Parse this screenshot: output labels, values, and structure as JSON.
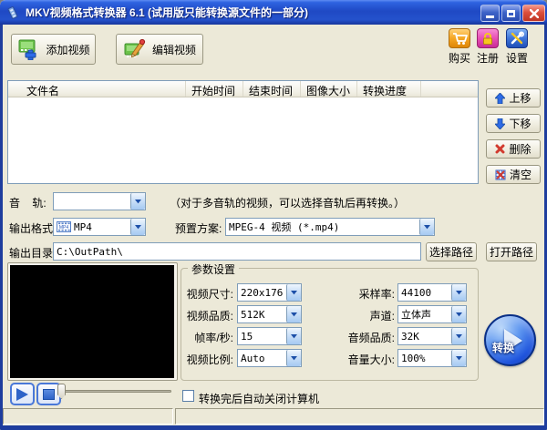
{
  "titlebar": {
    "title": "MKV视频格式转换器 6.1 (试用版只能转换源文件的一部分)"
  },
  "toolbar": {
    "add_video_label": "添加视频",
    "edit_video_label": "编辑视频",
    "buy_label": "购买",
    "register_label": "注册",
    "settings_label": "设置"
  },
  "file_list": {
    "columns": [
      "文件名",
      "开始时间",
      "结束时间",
      "图像大小",
      "转换进度"
    ],
    "rows": []
  },
  "list_actions": {
    "move_up": "上移",
    "move_down": "下移",
    "delete": "删除",
    "clear": "清空"
  },
  "audio_track": {
    "label": "音    轨:",
    "selected": "",
    "note": "（对于多音轨的视频，可以选择音轨后再转换。）"
  },
  "output": {
    "format_label": "输出格式:",
    "format_value": "MP4",
    "preset_label": "预置方案:",
    "preset_value": "MPEG-4 视频 (*.mp4)",
    "dir_label": "输出目录:",
    "dir_value": "C:\\OutPath\\",
    "choose_path_label": "选择路径",
    "open_path_label": "打开路径"
  },
  "params": {
    "title": "参数设置",
    "fields": [
      {
        "label": "视频尺寸:",
        "value": "220x176"
      },
      {
        "label": "视频品质:",
        "value": "512K"
      },
      {
        "label": "帧率/秒:",
        "value": "15"
      },
      {
        "label": "视频比例:",
        "value": "Auto"
      },
      {
        "label": "采样率:",
        "value": "44100"
      },
      {
        "label": "声道:",
        "value": "立体声"
      },
      {
        "label": "音频品质:",
        "value": "32K"
      },
      {
        "label": "音量大小:",
        "value": "100%"
      }
    ]
  },
  "convert_button": {
    "label": "转换"
  },
  "shutdown_option": {
    "label": "转换完后自动关闭计算机",
    "checked": false
  },
  "colors": {
    "titlebar_blue": "#1F49C4",
    "client_bg": "#ECE9D8",
    "close_red": "#DB4F3C",
    "accent_blue": "#2E6BE6",
    "buy_orange": "#F5A623",
    "register_pink": "#E84FB4"
  }
}
